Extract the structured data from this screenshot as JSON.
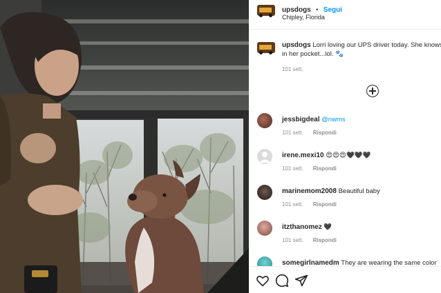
{
  "post": {
    "username": "upsdogs",
    "separator": "•",
    "follow_label": "Segui",
    "location": "Chipley, Florida",
    "caption_user": "upsdogs",
    "caption_text": "Lorri loving our UPS driver today. She knows she has treats in her pocket...lol. 🐾",
    "caption_line1": "Lorri loving our UPS driver today. She knows",
    "caption_line2": "in her pocket...lol. 🐾",
    "caption_age": "101 sett."
  },
  "comments": [
    {
      "user": "jessbigdeal",
      "text": "@nwms",
      "text_is_link": true,
      "age": "101 sett.",
      "reply": "Rispondi",
      "avatar": "brown-photo"
    },
    {
      "user": "irene.mexi10",
      "text": "😍😍😍🖤🖤🖤",
      "text_is_link": false,
      "age": "101 sett.",
      "reply": "Rispondi",
      "avatar": "default-gray"
    },
    {
      "user": "marinemom2008",
      "text": "Beautiful baby",
      "text_is_link": false,
      "age": "101 sett.",
      "reply": "Rispondi",
      "avatar": "dark-photo"
    },
    {
      "user": "itzthanomez",
      "text": "🖤",
      "text_is_link": false,
      "age": "101 sett.",
      "reply": "Rispondi",
      "avatar": "pink-photo"
    },
    {
      "user": "somegirlnamedm",
      "text": "They are wearing the same color",
      "text_is_link": false,
      "age": "",
      "reply": "",
      "avatar": "teal-photo"
    }
  ],
  "icons": {
    "load_more": "plus-circle-icon",
    "like": "heart-icon",
    "comment": "comment-icon",
    "share": "share-icon"
  },
  "colors": {
    "link": "#0095f6",
    "muted": "#8e8e8e",
    "text": "#262626"
  }
}
